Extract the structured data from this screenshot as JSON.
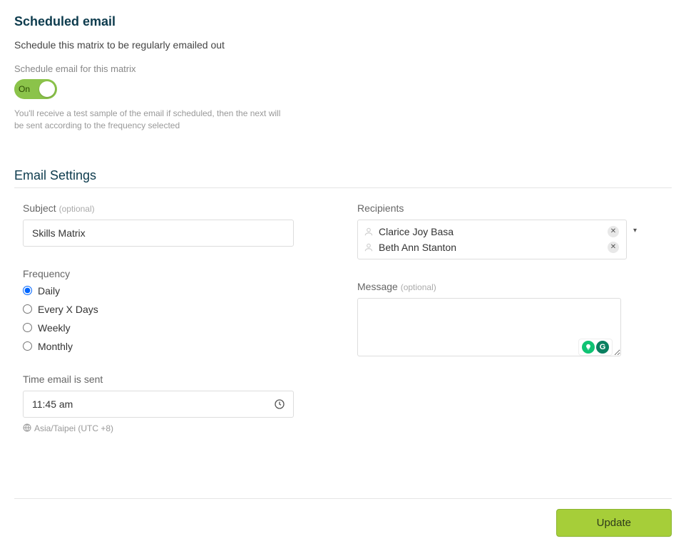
{
  "header": {
    "title": "Scheduled email",
    "description": "Schedule this matrix to be regularly emailed out",
    "toggle_label": "Schedule email for this matrix",
    "toggle_value": "On",
    "help_text": "You'll receive a test sample of the email if scheduled, then the next will be sent according to the frequency selected"
  },
  "settings": {
    "title": "Email Settings",
    "subject": {
      "label": "Subject",
      "optional": "(optional)",
      "value": "Skills Matrix"
    },
    "frequency": {
      "label": "Frequency",
      "options": [
        {
          "label": "Daily",
          "selected": true
        },
        {
          "label": "Every X Days",
          "selected": false
        },
        {
          "label": "Weekly",
          "selected": false
        },
        {
          "label": "Monthly",
          "selected": false
        }
      ]
    },
    "time": {
      "label": "Time email is sent",
      "value": "11:45 am",
      "timezone": "Asia/Taipei (UTC +8)"
    },
    "recipients": {
      "label": "Recipients",
      "list": [
        {
          "name": "Clarice Joy Basa"
        },
        {
          "name": "Beth Ann Stanton"
        }
      ]
    },
    "message": {
      "label": "Message",
      "optional": "(optional)",
      "value": ""
    }
  },
  "footer": {
    "update_label": "Update"
  }
}
